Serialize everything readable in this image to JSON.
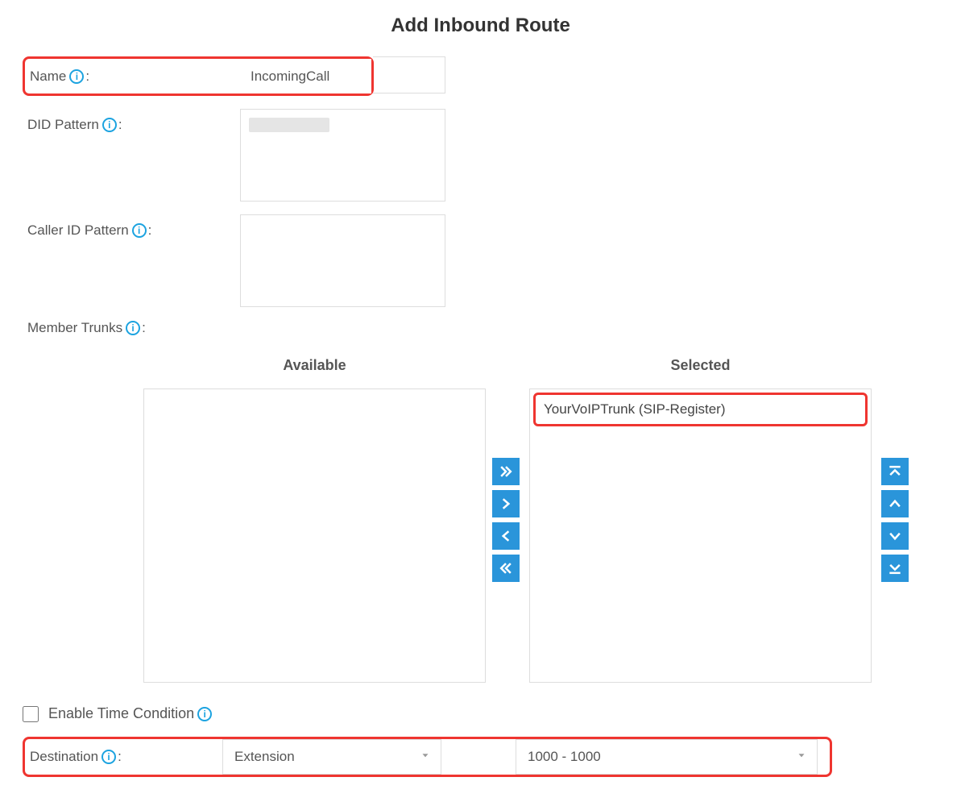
{
  "page_title": "Add Inbound Route",
  "fields": {
    "name": {
      "label": "Name",
      "suffix": ":",
      "value": "IncomingCall"
    },
    "did_pattern": {
      "label": "DID Pattern",
      "suffix": ":",
      "value": ""
    },
    "caller_id_pattern": {
      "label": "Caller ID Pattern",
      "suffix": ":",
      "value": ""
    },
    "member_trunks": {
      "label": "Member Trunks",
      "suffix": ":"
    },
    "enable_time_condition": {
      "label": "Enable Time Condition",
      "checked": false
    },
    "destination": {
      "label": "Destination",
      "suffix": ":",
      "type_value": "Extension",
      "target_value": "1000 - 1000"
    }
  },
  "trunks": {
    "available_header": "Available",
    "selected_header": "Selected",
    "available_items": [],
    "selected_items": [
      "YourVoIPTrunk (SIP-Register)"
    ]
  },
  "icons": {
    "info_glyph": "i"
  }
}
